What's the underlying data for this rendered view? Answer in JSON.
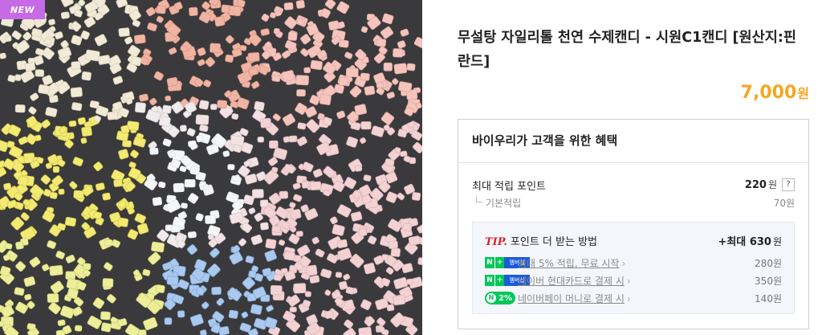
{
  "product": {
    "badge": "NEW",
    "title": "무설탕 자일리톨 천연 수제캔디 - 시원C1캔디 [원산지:핀란드]",
    "price": "7,000",
    "price_unit": "원"
  },
  "benefits": {
    "heading": "바이우리가 고객을 위한 혜택",
    "max_points_label": "최대 적립 포인트",
    "max_points_value": "220",
    "unit": "원",
    "help_icon": "?",
    "basic_label": "기본적립",
    "basic_value": "70원",
    "tip": {
      "tip_label": "TIP.",
      "heading": "포인트 더 받는 방법",
      "max_prefix": "+최대",
      "max_value": "630",
      "rows": [
        {
          "badge": "naverplus-membership-badge",
          "badge_text": "멤버십",
          "label": "최대 5% 적립, 무료 시작",
          "amount": "280원"
        },
        {
          "badge": "naverplus-membership-badge",
          "badge_text": "멤버십",
          "label": "네이버 현대카드로 결제 시",
          "amount": "350원"
        },
        {
          "badge": "naverpay-2percent-badge",
          "badge_text": "2%",
          "label": "네이버페이 머니로 결제 시",
          "amount": "140원"
        }
      ]
    }
  },
  "colors": {
    "accent_price": "#f5a623",
    "tip_red": "#d6242a",
    "naver_green": "#03c75a",
    "naver_blue": "#1b5bd7",
    "badge_purple": "#c66ae6"
  }
}
